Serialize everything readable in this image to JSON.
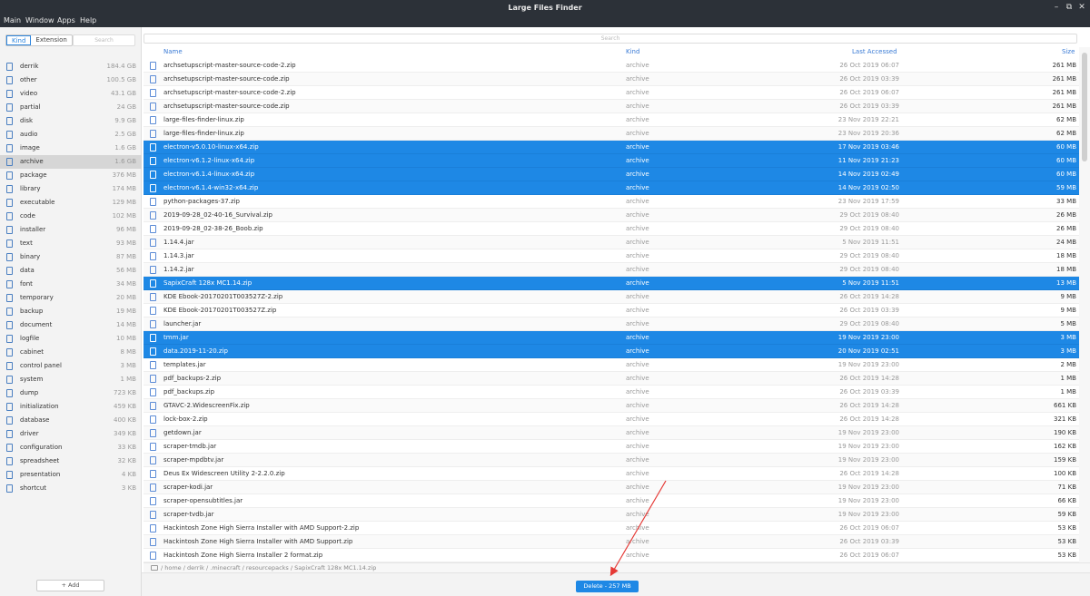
{
  "window": {
    "title": "Large Files Finder"
  },
  "menu": [
    "Main",
    "Window",
    "Apps",
    "Help"
  ],
  "sidebar": {
    "segments": [
      "Kind",
      "Extension"
    ],
    "search_placeholder": "Search",
    "items": [
      {
        "label": "derrik",
        "size": "184.4 GB"
      },
      {
        "label": "other",
        "size": "100.5 GB"
      },
      {
        "label": "video",
        "size": "43.1 GB"
      },
      {
        "label": "partial",
        "size": "24 GB"
      },
      {
        "label": "disk",
        "size": "9.9 GB"
      },
      {
        "label": "audio",
        "size": "2.5 GB"
      },
      {
        "label": "image",
        "size": "1.6 GB"
      },
      {
        "label": "archive",
        "size": "1.6 GB"
      },
      {
        "label": "package",
        "size": "376 MB"
      },
      {
        "label": "library",
        "size": "174 MB"
      },
      {
        "label": "executable",
        "size": "129 MB"
      },
      {
        "label": "code",
        "size": "102 MB"
      },
      {
        "label": "installer",
        "size": "96 MB"
      },
      {
        "label": "text",
        "size": "93 MB"
      },
      {
        "label": "binary",
        "size": "87 MB"
      },
      {
        "label": "data",
        "size": "56 MB"
      },
      {
        "label": "font",
        "size": "34 MB"
      },
      {
        "label": "temporary",
        "size": "20 MB"
      },
      {
        "label": "backup",
        "size": "19 MB"
      },
      {
        "label": "document",
        "size": "14 MB"
      },
      {
        "label": "logfile",
        "size": "10 MB"
      },
      {
        "label": "cabinet",
        "size": "8 MB"
      },
      {
        "label": "control panel",
        "size": "3 MB"
      },
      {
        "label": "system",
        "size": "1 MB"
      },
      {
        "label": "dump",
        "size": "723 KB"
      },
      {
        "label": "initialization",
        "size": "459 KB"
      },
      {
        "label": "database",
        "size": "400 KB"
      },
      {
        "label": "driver",
        "size": "349 KB"
      },
      {
        "label": "configuration",
        "size": "33 KB"
      },
      {
        "label": "spreadsheet",
        "size": "32 KB"
      },
      {
        "label": "presentation",
        "size": "4 KB"
      },
      {
        "label": "shortcut",
        "size": "3 KB"
      }
    ],
    "selected_index": 7,
    "add_label": "+ Add"
  },
  "main": {
    "search_placeholder": "Search",
    "columns": [
      "Name",
      "Kind",
      "Last Accessed",
      "Size"
    ],
    "rows": [
      {
        "name": "archsetupscript-master-source-code-2.zip",
        "kind": "archive",
        "date": "26 Oct 2019 06:07",
        "size": "261 MB",
        "sel": false
      },
      {
        "name": "archsetupscript-master-source-code.zip",
        "kind": "archive",
        "date": "26 Oct 2019 03:39",
        "size": "261 MB",
        "sel": false
      },
      {
        "name": "archsetupscript-master-source-code-2.zip",
        "kind": "archive",
        "date": "26 Oct 2019 06:07",
        "size": "261 MB",
        "sel": false
      },
      {
        "name": "archsetupscript-master-source-code.zip",
        "kind": "archive",
        "date": "26 Oct 2019 03:39",
        "size": "261 MB",
        "sel": false
      },
      {
        "name": "large-files-finder-linux.zip",
        "kind": "archive",
        "date": "23 Nov 2019 22:21",
        "size": "62 MB",
        "sel": false
      },
      {
        "name": "large-files-finder-linux.zip",
        "kind": "archive",
        "date": "23 Nov 2019 20:36",
        "size": "62 MB",
        "sel": false
      },
      {
        "name": "electron-v5.0.10-linux-x64.zip",
        "kind": "archive",
        "date": "17 Nov 2019 03:46",
        "size": "60 MB",
        "sel": true
      },
      {
        "name": "electron-v6.1.2-linux-x64.zip",
        "kind": "archive",
        "date": "11 Nov 2019 21:23",
        "size": "60 MB",
        "sel": true
      },
      {
        "name": "electron-v6.1.4-linux-x64.zip",
        "kind": "archive",
        "date": "14 Nov 2019 02:49",
        "size": "60 MB",
        "sel": true
      },
      {
        "name": "electron-v6.1.4-win32-x64.zip",
        "kind": "archive",
        "date": "14 Nov 2019 02:50",
        "size": "59 MB",
        "sel": true
      },
      {
        "name": "python-packages-37.zip",
        "kind": "archive",
        "date": "23 Nov 2019 17:59",
        "size": "33 MB",
        "sel": false
      },
      {
        "name": "2019-09-28_02-40-16_Survival.zip",
        "kind": "archive",
        "date": "29 Oct 2019 08:40",
        "size": "26 MB",
        "sel": false
      },
      {
        "name": "2019-09-28_02-38-26_Boob.zip",
        "kind": "archive",
        "date": "29 Oct 2019 08:40",
        "size": "26 MB",
        "sel": false
      },
      {
        "name": "1.14.4.jar",
        "kind": "archive",
        "date": "5 Nov 2019 11:51",
        "size": "24 MB",
        "sel": false
      },
      {
        "name": "1.14.3.jar",
        "kind": "archive",
        "date": "29 Oct 2019 08:40",
        "size": "18 MB",
        "sel": false
      },
      {
        "name": "1.14.2.jar",
        "kind": "archive",
        "date": "29 Oct 2019 08:40",
        "size": "18 MB",
        "sel": false
      },
      {
        "name": "SapixCraft 128x MC1.14.zip",
        "kind": "archive",
        "date": "5 Nov 2019 11:51",
        "size": "13 MB",
        "sel": true
      },
      {
        "name": "KDE Ebook-20170201T003527Z-2.zip",
        "kind": "archive",
        "date": "26 Oct 2019 14:28",
        "size": "9 MB",
        "sel": false
      },
      {
        "name": "KDE Ebook-20170201T003527Z.zip",
        "kind": "archive",
        "date": "26 Oct 2019 03:39",
        "size": "9 MB",
        "sel": false
      },
      {
        "name": "launcher.jar",
        "kind": "archive",
        "date": "29 Oct 2019 08:40",
        "size": "5 MB",
        "sel": false
      },
      {
        "name": "tmm.jar",
        "kind": "archive",
        "date": "19 Nov 2019 23:00",
        "size": "3 MB",
        "sel": true
      },
      {
        "name": "data.2019-11-20.zip",
        "kind": "archive",
        "date": "20 Nov 2019 02:51",
        "size": "3 MB",
        "sel": true
      },
      {
        "name": "templates.jar",
        "kind": "archive",
        "date": "19 Nov 2019 23:00",
        "size": "2 MB",
        "sel": false
      },
      {
        "name": "pdf_backups-2.zip",
        "kind": "archive",
        "date": "26 Oct 2019 14:28",
        "size": "1 MB",
        "sel": false
      },
      {
        "name": "pdf_backups.zip",
        "kind": "archive",
        "date": "26 Oct 2019 03:39",
        "size": "1 MB",
        "sel": false
      },
      {
        "name": "GTAVC-2.WidescreenFix.zip",
        "kind": "archive",
        "date": "26 Oct 2019 14:28",
        "size": "661 KB",
        "sel": false
      },
      {
        "name": "lock-box-2.zip",
        "kind": "archive",
        "date": "26 Oct 2019 14:28",
        "size": "321 KB",
        "sel": false
      },
      {
        "name": "getdown.jar",
        "kind": "archive",
        "date": "19 Nov 2019 23:00",
        "size": "190 KB",
        "sel": false
      },
      {
        "name": "scraper-tmdb.jar",
        "kind": "archive",
        "date": "19 Nov 2019 23:00",
        "size": "162 KB",
        "sel": false
      },
      {
        "name": "scraper-mpdbtv.jar",
        "kind": "archive",
        "date": "19 Nov 2019 23:00",
        "size": "159 KB",
        "sel": false
      },
      {
        "name": "Deus Ex Widescreen Utility 2-2.2.0.zip",
        "kind": "archive",
        "date": "26 Oct 2019 14:28",
        "size": "100 KB",
        "sel": false
      },
      {
        "name": "scraper-kodi.jar",
        "kind": "archive",
        "date": "19 Nov 2019 23:00",
        "size": "71 KB",
        "sel": false
      },
      {
        "name": "scraper-opensubtitles.jar",
        "kind": "archive",
        "date": "19 Nov 2019 23:00",
        "size": "66 KB",
        "sel": false
      },
      {
        "name": "scraper-tvdb.jar",
        "kind": "archive",
        "date": "19 Nov 2019 23:00",
        "size": "59 KB",
        "sel": false
      },
      {
        "name": "Hackintosh Zone High Sierra Installer with AMD Support-2.zip",
        "kind": "archive",
        "date": "26 Oct 2019 06:07",
        "size": "53 KB",
        "sel": false
      },
      {
        "name": "Hackintosh Zone High Sierra Installer with AMD Support.zip",
        "kind": "archive",
        "date": "26 Oct 2019 03:39",
        "size": "53 KB",
        "sel": false
      },
      {
        "name": "Hackintosh Zone High Sierra Installer 2 format.zip",
        "kind": "archive",
        "date": "26 Oct 2019 06:07",
        "size": "53 KB",
        "sel": false
      }
    ],
    "path": "/ home / derrik / .minecraft / resourcepacks / SapixCraft 128x MC1.14.zip",
    "delete_label": "Delete - 257 MB"
  },
  "colors": {
    "accent": "#1e88e5",
    "titlebar": "#2c3138",
    "annotation": "#e53935"
  }
}
